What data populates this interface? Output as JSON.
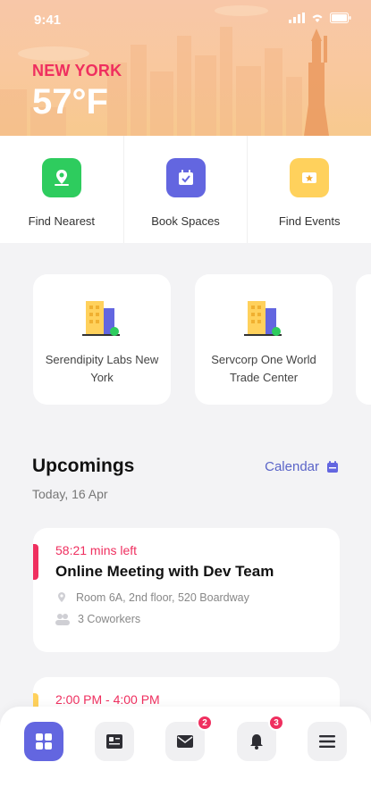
{
  "status": {
    "time": "9:41"
  },
  "weather": {
    "city": "NEW YORK",
    "temperature": "57°F"
  },
  "quick_actions": [
    {
      "label": "Find Nearest",
      "icon": "map-pin-icon",
      "color": "#2ecc5e"
    },
    {
      "label": "Book Spaces",
      "icon": "calendar-check-icon",
      "color": "#6366e0"
    },
    {
      "label": "Find Events",
      "icon": "ticket-star-icon",
      "color": "#ffd15c"
    }
  ],
  "locations": [
    {
      "name": "Serendipity Labs New York",
      "icon": "building-icon"
    },
    {
      "name": "Servcorp One World Trade Center",
      "icon": "building-icon"
    }
  ],
  "upcomings": {
    "title": "Upcomings",
    "date": "Today, 16 Apr",
    "calendar_label": "Calendar",
    "events": [
      {
        "time": "58:21 mins left",
        "title": "Online Meeting with Dev Team",
        "location": "Room 6A, 2nd floor, 520 Boardway",
        "attendees": "3 Coworkers",
        "accent": "#ef2f5f"
      },
      {
        "time": "2:00 PM - 4:00 PM",
        "accent": "#ffd15c"
      }
    ]
  },
  "bottom_nav": {
    "items": [
      {
        "icon": "grid-icon",
        "active": true
      },
      {
        "icon": "id-card-icon",
        "active": false
      },
      {
        "icon": "mail-icon",
        "active": false,
        "badge": "2"
      },
      {
        "icon": "bell-icon",
        "active": false,
        "badge": "3"
      },
      {
        "icon": "menu-icon",
        "active": false
      }
    ]
  },
  "colors": {
    "accent": "#6366e0",
    "alert": "#ef2f5f",
    "green": "#2ecc5e",
    "yellow": "#ffd15c"
  }
}
